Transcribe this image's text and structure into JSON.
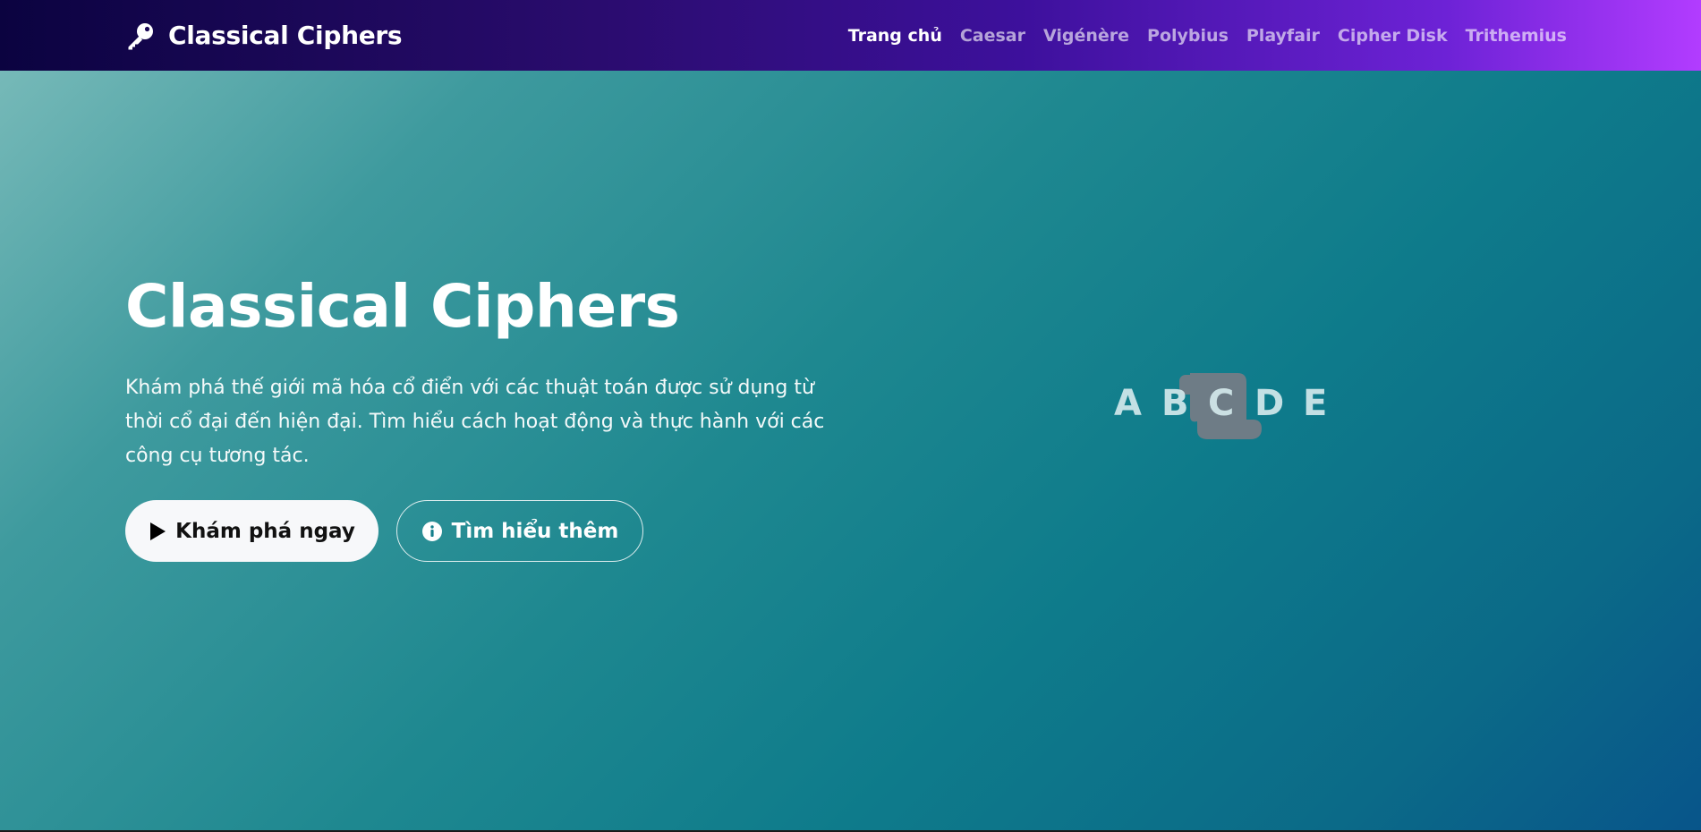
{
  "navbar": {
    "brand": "Classical Ciphers",
    "brand_icon": "key-icon",
    "links": [
      {
        "label": "Trang chủ",
        "active": true
      },
      {
        "label": "Caesar",
        "active": false
      },
      {
        "label": "Vigénère",
        "active": false
      },
      {
        "label": "Polybius",
        "active": false
      },
      {
        "label": "Playfair",
        "active": false
      },
      {
        "label": "Cipher Disk",
        "active": false
      },
      {
        "label": "Trithemius",
        "active": false
      }
    ]
  },
  "hero": {
    "title": "Classical Ciphers",
    "description": "Khám phá thế giới mã hóa cổ điển với các thuật toán được sử dụng từ thời cổ đại đến hiện đại. Tìm hiểu cách hoạt động và thực hành với các công cụ tương tác.",
    "primary_button": {
      "label": "Khám phá ngay",
      "icon": "play-icon"
    },
    "secondary_button": {
      "label": "Tìm hiểu thêm",
      "icon": "info-icon"
    },
    "cipher_letters": [
      "A",
      "B",
      "C",
      "D",
      "E"
    ],
    "illustration_icon": "scroll-icon"
  },
  "colors": {
    "navbar_start": "#0b0340",
    "navbar_end": "#b23cff",
    "hero_start": "#76b9b8",
    "hero_end": "#08558a",
    "primary_button_bg": "#f7f8fa"
  }
}
